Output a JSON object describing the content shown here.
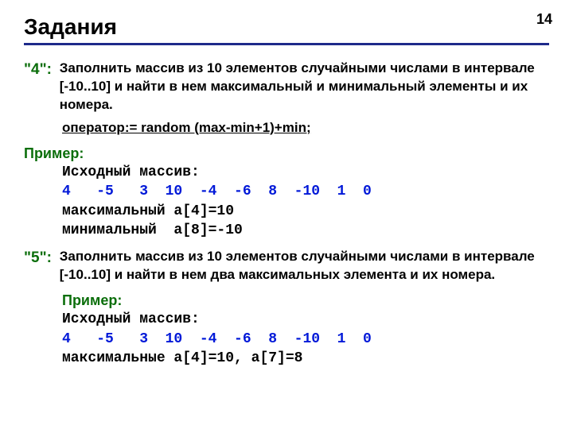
{
  "pageNumber": "14",
  "title": "Задания",
  "task4": {
    "label": "\"4\":",
    "text": "Заполнить массив из 10 элементов случайными числами в интервале [-10..10] и найти в нем максимальный и минимальный элементы и их номера.",
    "operator": "оператор:= random (max-min+1)+min;",
    "exampleLabel": "Пример:",
    "arrayLabel": "Исходный массив:",
    "array": "4   -5   3  10  -4  -6  8  -10  1  0",
    "maxLine": "максимальный a[4]=10",
    "minLine": "минимальный  a[8]=-10"
  },
  "task5": {
    "label": "\"5\":",
    "text": "Заполнить массив из 10 элементов случайными числами в интервале [-10..10] и найти в нем два максимальных элемента и их номера.",
    "exampleLabel": "Пример:",
    "arrayLabel": "Исходный массив:",
    "array": "4   -5   3  10  -4  -6  8  -10  1  0",
    "maxLine": "максимальные a[4]=10, a[7]=8"
  }
}
